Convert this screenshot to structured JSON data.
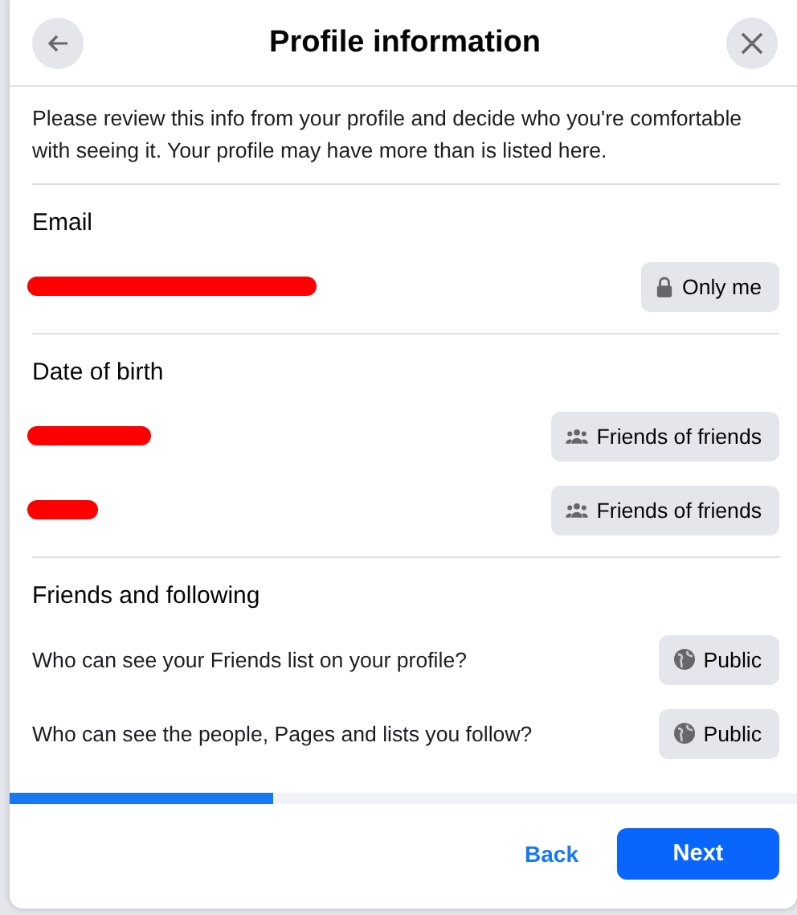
{
  "dialog": {
    "title": "Profile information",
    "intro": "Please review this info from your profile and decide who you're comfortable with seeing it. Your profile may have more than is listed here."
  },
  "sections": [
    {
      "heading": "Email",
      "rows": [
        {
          "kind": "redacted",
          "audience": {
            "kind": "private",
            "label": "Only me"
          }
        }
      ]
    },
    {
      "heading": "Date of birth",
      "rows": [
        {
          "kind": "redacted",
          "audience": {
            "kind": "friends",
            "label": "Friends of friends"
          }
        },
        {
          "kind": "redacted",
          "audience": {
            "kind": "friends",
            "label": "Friends of friends"
          }
        }
      ]
    },
    {
      "heading": "Friends and following",
      "rows": [
        {
          "kind": "question",
          "text": "Who can see your Friends list on your profile?",
          "audience": {
            "kind": "public",
            "label": "Public"
          }
        },
        {
          "kind": "question",
          "text": "Who can see the people, Pages and lists you follow?",
          "audience": {
            "kind": "public",
            "label": "Public"
          }
        }
      ]
    }
  ],
  "progress": {
    "level": 0.335
  },
  "footer": {
    "back": "Back",
    "next": "Next"
  }
}
